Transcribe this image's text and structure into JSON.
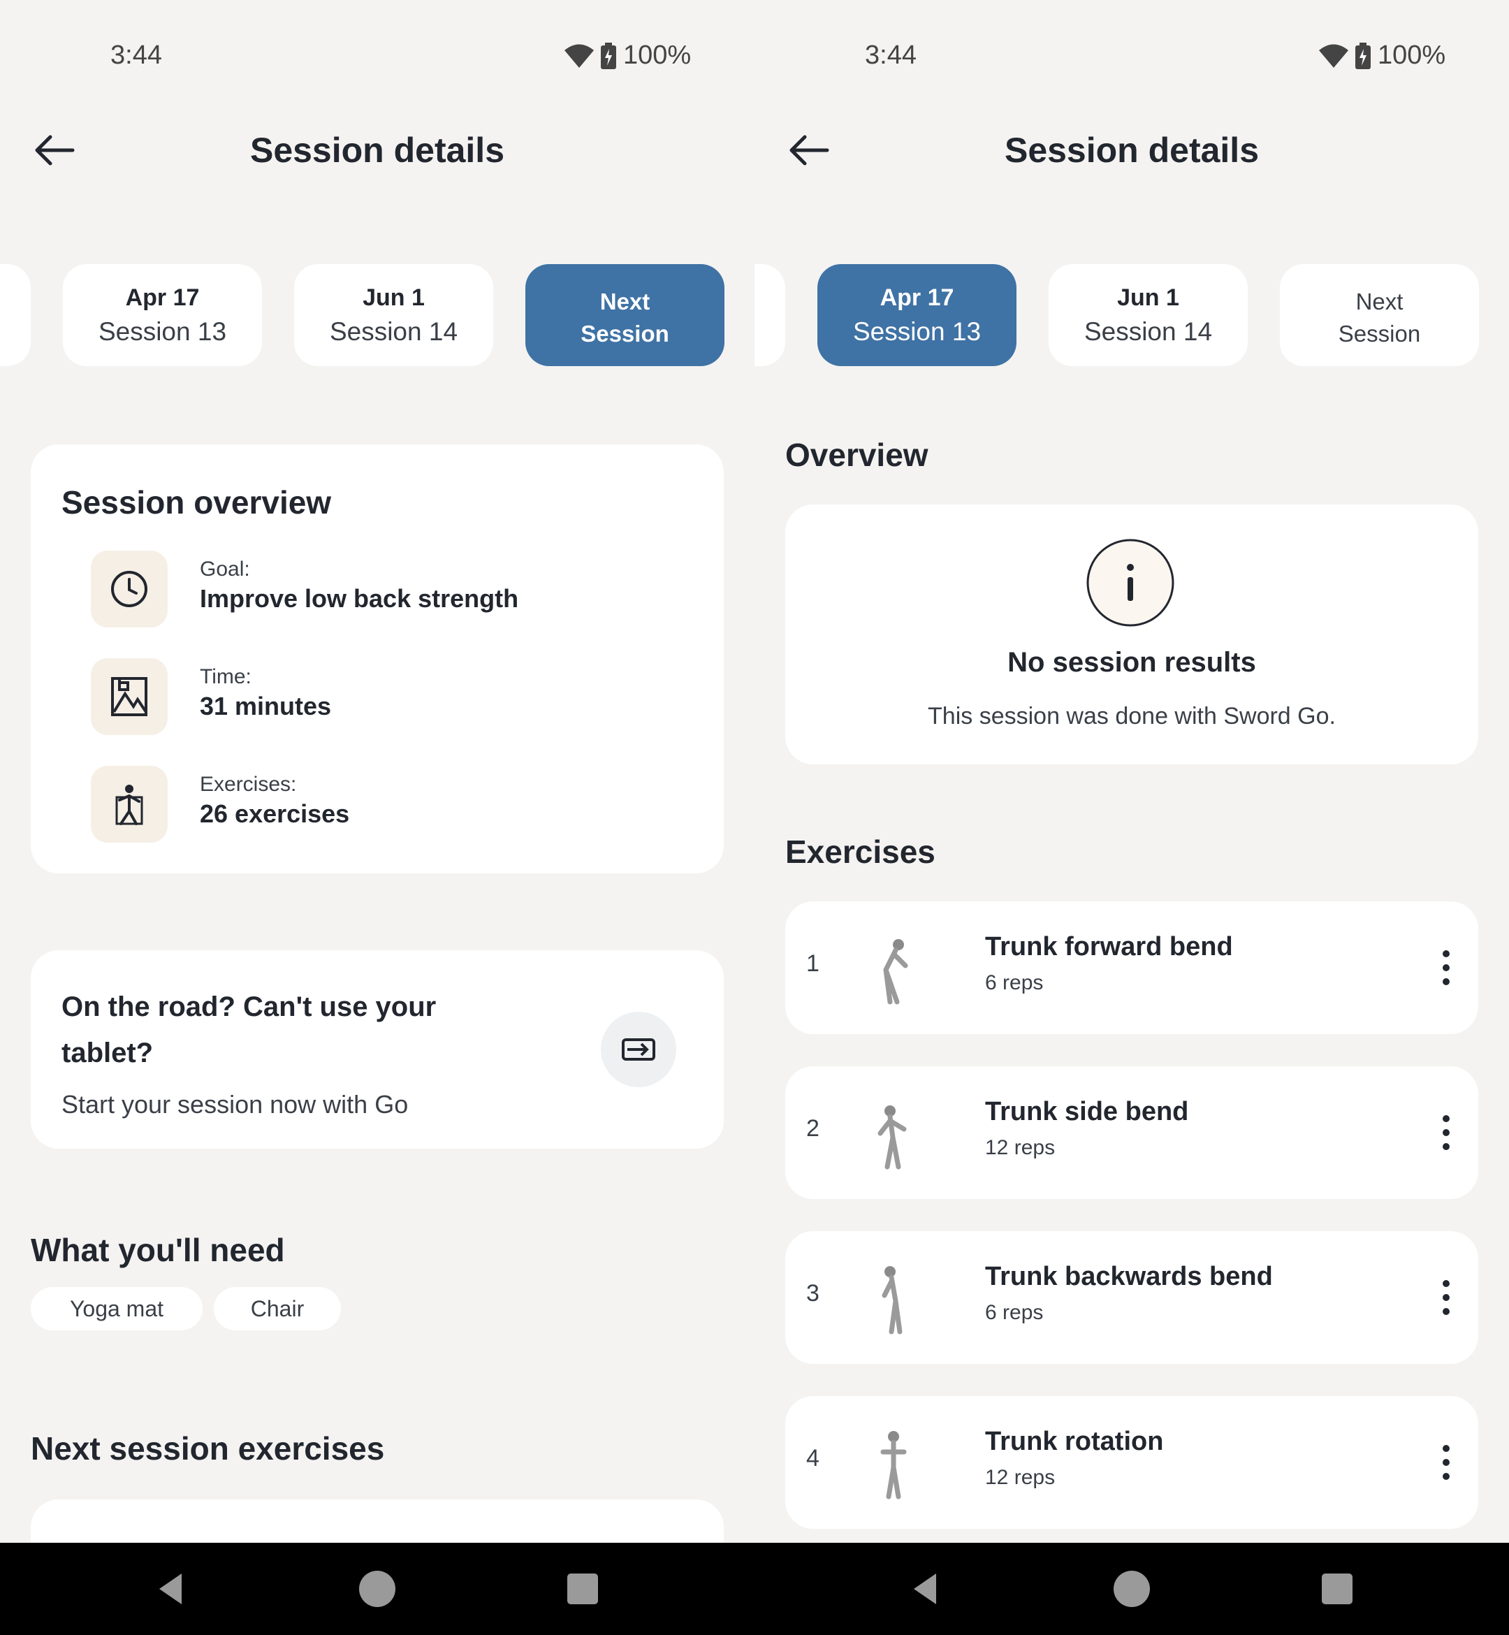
{
  "status": {
    "time": "3:44",
    "battery": "100%"
  },
  "appbar": {
    "title": "Session details",
    "back_icon": "arrow-left-icon"
  },
  "chips": [
    {
      "date": "Apr 17",
      "session": "Session 13"
    },
    {
      "date": "Jun 1",
      "session": "Session 14"
    },
    {
      "line1": "Next",
      "line2": "Session"
    }
  ],
  "left": {
    "overview": {
      "title": "Session overview",
      "goal_label": "Goal:",
      "goal_value": "Improve low back strength",
      "time_label": "Time:",
      "time_value": "31 minutes",
      "exercises_label": "Exercises:",
      "exercises_value": "26 exercises"
    },
    "promo": {
      "title_line1": "On the road? Can't use your",
      "title_line2": "tablet?",
      "subtitle": "Start your session now with Go"
    },
    "needs": {
      "title": "What you'll need",
      "items": [
        "Yoga mat",
        "Chair"
      ]
    },
    "next_exercises": {
      "title": "Next session exercises"
    }
  },
  "right": {
    "overview_title": "Overview",
    "no_results": {
      "title": "No session results",
      "subtitle": "This session was done with Sword Go."
    },
    "exercises_title": "Exercises",
    "exercises": [
      {
        "num": "1",
        "name": "Trunk forward bend",
        "reps": "6 reps"
      },
      {
        "num": "2",
        "name": "Trunk side bend",
        "reps": "12 reps"
      },
      {
        "num": "3",
        "name": "Trunk backwards bend",
        "reps": "6 reps"
      },
      {
        "num": "4",
        "name": "Trunk rotation",
        "reps": "12 reps"
      }
    ]
  },
  "colors": {
    "accent": "#3f72a5",
    "background": "#f4f3f1",
    "card": "#ffffff",
    "icon_tile": "#f5efe6"
  }
}
